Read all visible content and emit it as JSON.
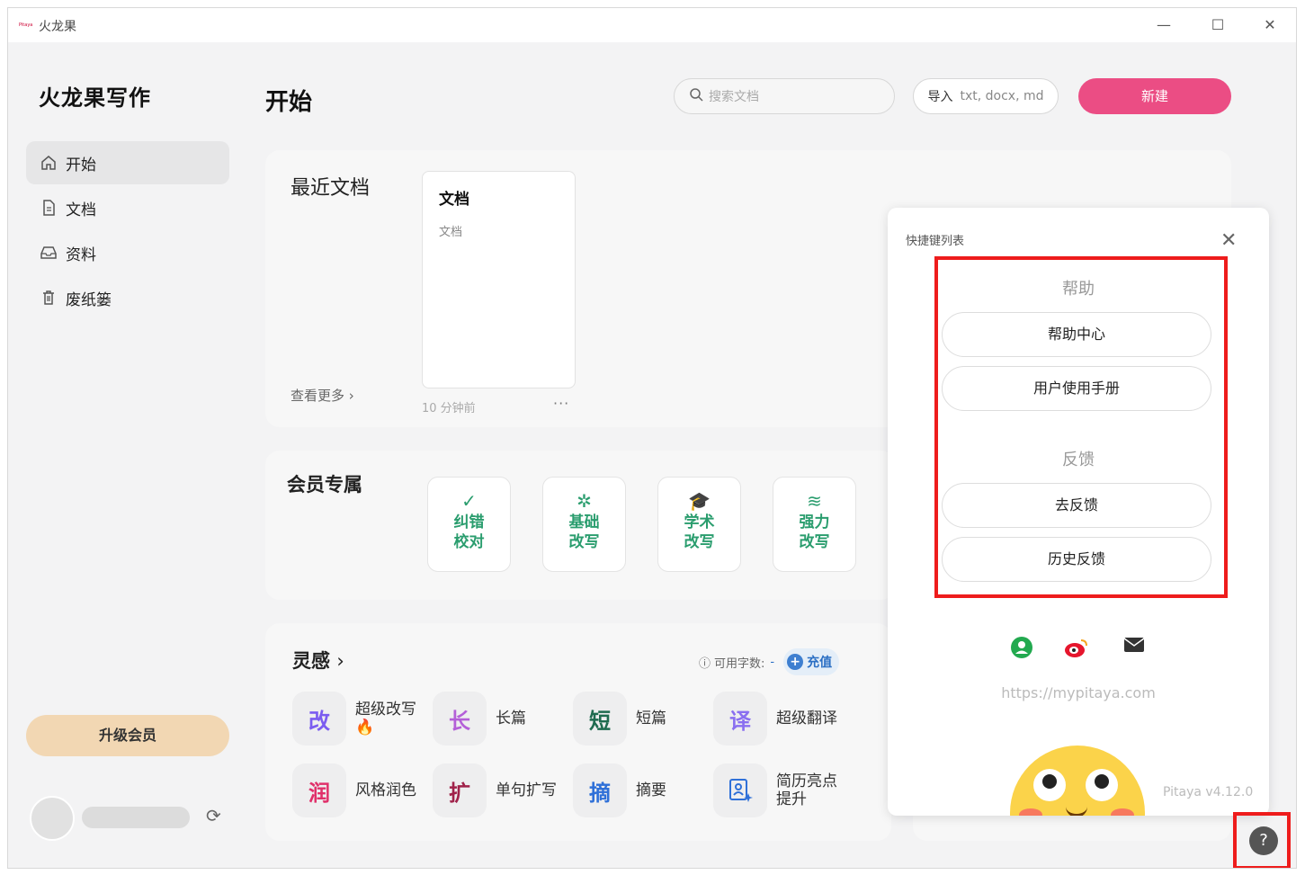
{
  "window": {
    "title": "火龙果",
    "logo_text": "Pitaya"
  },
  "sidebar": {
    "brand": "火龙果写作",
    "items": [
      {
        "label": "开始",
        "icon": "home-icon"
      },
      {
        "label": "文档",
        "icon": "document-icon"
      },
      {
        "label": "资料",
        "icon": "inbox-icon"
      },
      {
        "label": "废纸篓",
        "icon": "trash-icon"
      }
    ],
    "upgrade_label": "升级会员"
  },
  "header": {
    "title": "开始",
    "search_placeholder": "搜索文档",
    "import_label": "导入",
    "import_ext": "txt, docx, md",
    "new_label": "新建"
  },
  "recent": {
    "title": "最近文档",
    "see_more": "查看更多",
    "doc": {
      "title": "文档",
      "subtitle": "文档",
      "time": "10 分钟前",
      "more": "···"
    }
  },
  "vip": {
    "title": "会员专属",
    "tools": [
      {
        "line1": "纠错",
        "line2": "校对",
        "icon": "check-icon"
      },
      {
        "line1": "基础",
        "line2": "改写",
        "icon": "magic-wand-icon"
      },
      {
        "line1": "学术",
        "line2": "改写",
        "icon": "graduation-cap-icon"
      },
      {
        "line1": "强力",
        "line2": "改写",
        "icon": "tornado-icon"
      }
    ]
  },
  "inspiration": {
    "title": "灵感",
    "word_count_label": "可用字数:",
    "word_count_value": "-",
    "recharge_label": "充值",
    "items": [
      {
        "badge": "改",
        "label": "超级改写",
        "emoji": "🔥",
        "color": "#7b5cf0"
      },
      {
        "badge": "长",
        "label": "长篇",
        "color": "#b45fd8"
      },
      {
        "badge": "短",
        "label": "短篇",
        "color": "#1f6b4f"
      },
      {
        "badge": "译",
        "label": "超级翻译",
        "color": "#8a6ff0"
      },
      {
        "badge": "润",
        "label": "风格润色",
        "color": "#e0306a"
      },
      {
        "badge": "扩",
        "label": "单句扩写",
        "color": "#a0224a"
      },
      {
        "badge": "摘",
        "label": "摘要",
        "color": "#2f70d8"
      },
      {
        "badge": "",
        "label": "简历亮点提升",
        "color": "#2f70d8"
      }
    ]
  },
  "panel": {
    "title": "快捷键列表",
    "help_heading": "帮助",
    "help_center": "帮助中心",
    "user_manual": "用户使用手册",
    "feedback_heading": "反馈",
    "go_feedback": "去反馈",
    "history_feedback": "历史反馈",
    "site": "https://mypitaya.com",
    "version": "Pitaya v4.12.0"
  },
  "help_button": {
    "glyph": "?"
  }
}
